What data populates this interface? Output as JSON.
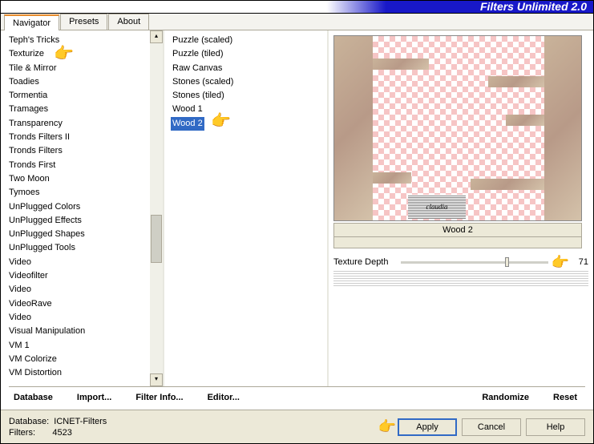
{
  "title": "Filters Unlimited 2.0",
  "tabs": [
    "Navigator",
    "Presets",
    "About"
  ],
  "activeTab": 0,
  "categories": [
    "Teph's Tricks",
    "Texturize",
    "Tile & Mirror",
    "Toadies",
    "Tormentia",
    "Tramages",
    "Transparency",
    "Tronds Filters II",
    "Tronds Filters",
    "Tronds First",
    "Two Moon",
    "Tymoes",
    "UnPlugged Colors",
    "UnPlugged Effects",
    "UnPlugged Shapes",
    "UnPlugged Tools",
    "Video",
    "Videofilter",
    "Video",
    "VideoRave",
    "Video",
    "Visual Manipulation",
    "VM 1",
    "VM Colorize",
    "VM Distortion"
  ],
  "filters": [
    "Puzzle (scaled)",
    "Puzzle (tiled)",
    "Raw Canvas",
    "Stones (scaled)",
    "Stones (tiled)",
    "Wood 1",
    "Wood 2"
  ],
  "selectedFilterIndex": 6,
  "previewLabel": "Wood 2",
  "watermark": "claudia",
  "slider": {
    "label": "Texture Depth",
    "value": "71",
    "percent": 71
  },
  "toolbar": {
    "database": "Database",
    "import": "Import...",
    "filterinfo": "Filter Info...",
    "editor": "Editor...",
    "randomize": "Randomize",
    "reset": "Reset"
  },
  "footer": {
    "dbLabel": "Database:",
    "dbValue": "ICNET-Filters",
    "filtersLabel": "Filters:",
    "filtersValue": "4523"
  },
  "buttons": {
    "apply": "Apply",
    "cancel": "Cancel",
    "help": "Help"
  }
}
